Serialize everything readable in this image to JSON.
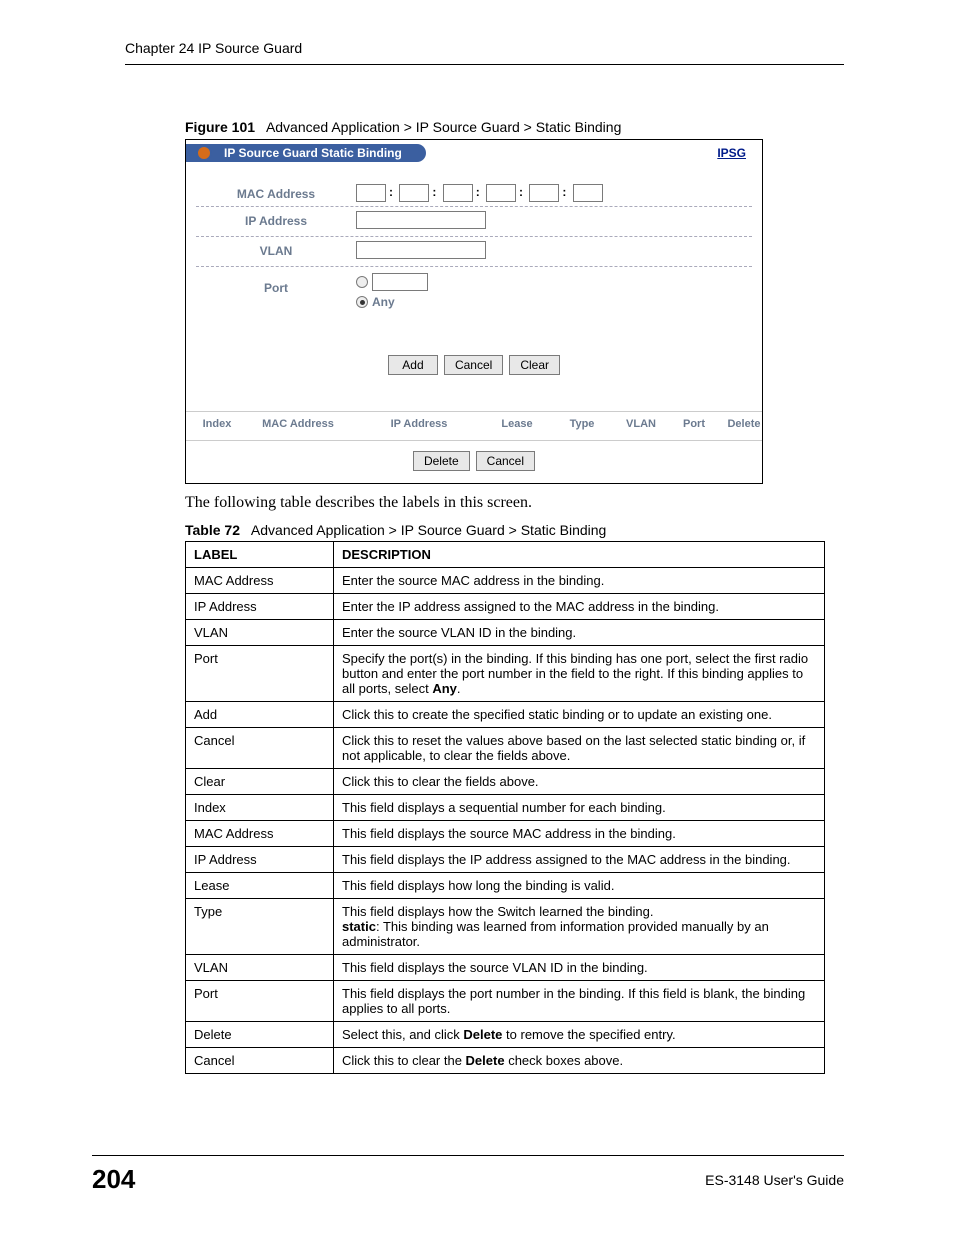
{
  "header": {
    "chapter": "Chapter 24 IP Source Guard"
  },
  "figure": {
    "caption_num": "Figure 101",
    "caption_title": "Advanced Application > IP Source Guard > Static Binding",
    "panel_title": "IP Source Guard Static Binding",
    "link": "IPSG",
    "fields": {
      "mac": "MAC Address",
      "ip": "IP Address",
      "vlan": "VLAN",
      "port": "Port",
      "any": "Any"
    },
    "buttons": {
      "add": "Add",
      "cancel": "Cancel",
      "clear": "Clear",
      "delete": "Delete",
      "cancel2": "Cancel"
    },
    "grid_headers": {
      "index": "Index",
      "mac": "MAC Address",
      "ip": "IP Address",
      "lease": "Lease",
      "type": "Type",
      "vlan": "VLAN",
      "port": "Port",
      "delete": "Delete"
    }
  },
  "body_text": "The following table describes the labels in this screen.",
  "table": {
    "caption_num": "Table 72",
    "caption_title": "Advanced Application > IP Source Guard > Static Binding",
    "headers": {
      "label": "LABEL",
      "desc": "DESCRIPTION"
    },
    "rows": [
      {
        "label": "MAC Address",
        "desc": "Enter the source MAC address in the binding."
      },
      {
        "label": "IP Address",
        "desc": "Enter the IP address assigned to the MAC address in the binding."
      },
      {
        "label": "VLAN",
        "desc": "Enter the source VLAN ID in the binding."
      },
      {
        "label": "Port",
        "desc_pre": "Specify the port(s) in the binding. If this binding has one port, select the first radio button and enter the port number in the field to the right. If this binding applies to all ports, select ",
        "desc_bold": "Any",
        "desc_post": "."
      },
      {
        "label": "Add",
        "desc": "Click this to create the specified static binding or to update an existing one."
      },
      {
        "label": "Cancel",
        "desc": "Click this to reset the values above based on the last selected static binding or, if not applicable, to clear the fields above."
      },
      {
        "label": "Clear",
        "desc": "Click this to clear the fields above."
      },
      {
        "label": "Index",
        "desc": "This field displays a sequential number for each binding."
      },
      {
        "label": "MAC Address",
        "desc": "This field displays the source MAC address in the binding."
      },
      {
        "label": "IP Address",
        "desc": "This field displays the IP address assigned to the MAC address in the binding."
      },
      {
        "label": "Lease",
        "desc": "This field displays how long the binding is valid."
      },
      {
        "label": "Type",
        "desc_line1": "This field displays how the Switch learned the binding.",
        "desc_bold": "static",
        "desc_line2": ": This binding was learned from information provided manually by an administrator."
      },
      {
        "label": "VLAN",
        "desc": "This field displays the source VLAN ID in the binding."
      },
      {
        "label": "Port",
        "desc": "This field displays the port number in the binding. If this field is blank, the binding applies to all ports."
      },
      {
        "label": "Delete",
        "desc_pre": "Select this, and click ",
        "desc_bold": "Delete",
        "desc_post": " to remove the specified entry."
      },
      {
        "label": "Cancel",
        "desc_pre": "Click this to clear the ",
        "desc_bold": "Delete",
        "desc_post": " check boxes above."
      }
    ]
  },
  "footer": {
    "page": "204",
    "guide": "ES-3148 User's Guide"
  }
}
